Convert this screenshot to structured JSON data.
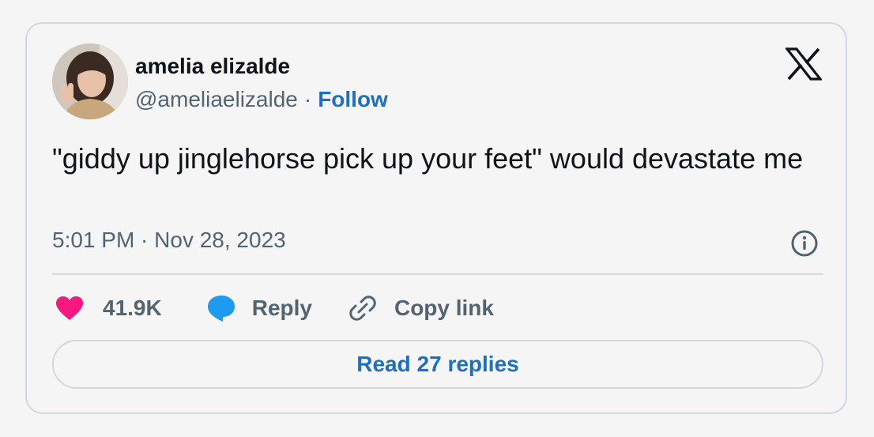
{
  "author": {
    "name": "amelia elizalde",
    "handle": "@ameliaelizalde",
    "separator": "·",
    "follow_label": "Follow",
    "avatar_icon": "profile-photo"
  },
  "platform_icon": "x-logo-icon",
  "tweet": {
    "text": "\"giddy up jinglehorse pick up your feet\" would devastate me",
    "timestamp": "5:01 PM · Nov 28, 2023"
  },
  "actions": {
    "likes_count": "41.9K",
    "reply_label": "Reply",
    "copy_link_label": "Copy link"
  },
  "read_replies_label": "Read 27 replies",
  "colors": {
    "accent": "#1d6fc4",
    "heart": "#f91880",
    "reply_bubble": "#1d9bf0",
    "secondary_text": "#536471",
    "primary_text": "#0f1419",
    "border": "#cfd9de"
  }
}
